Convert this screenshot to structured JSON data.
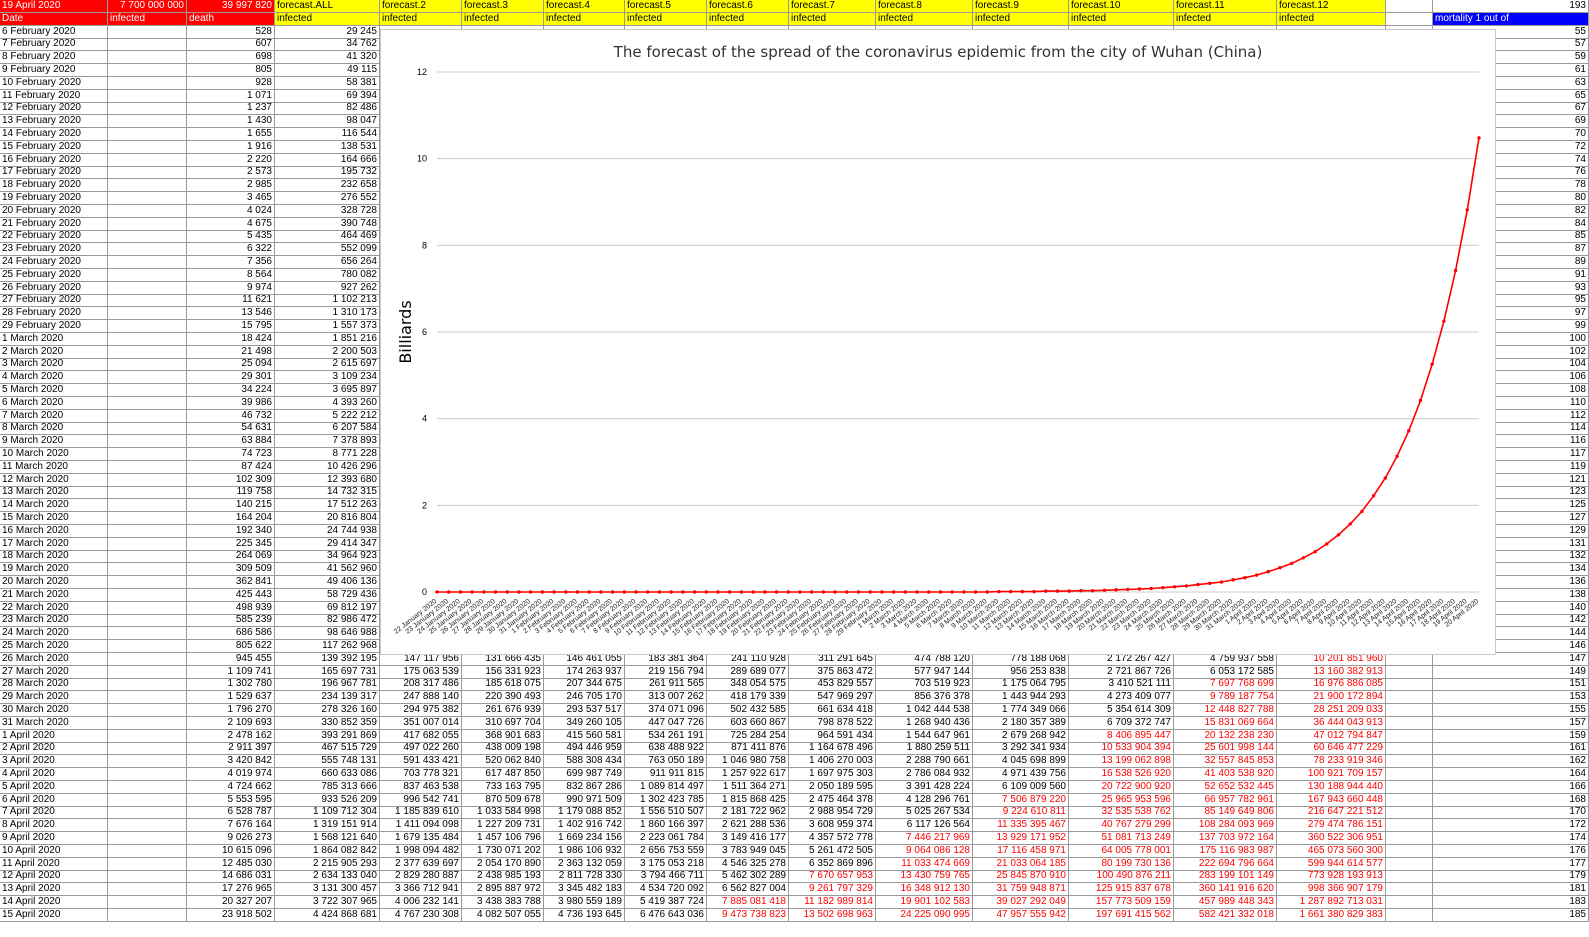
{
  "header": {
    "date_cell": "19 April 2020",
    "population": "7 700 000 000",
    "deaths_total": "39 997 820",
    "forecast_all": "forecast.ALL",
    "forecasts": [
      "forecast.2",
      "forecast.3",
      "forecast.4",
      "forecast.5",
      "forecast.6",
      "forecast.7",
      "forecast.8",
      "forecast.9",
      "forecast.10",
      "forecast.11",
      "forecast.12"
    ],
    "top_right_value": "193",
    "mortality_label": "mortality 1 out of"
  },
  "subheader": {
    "date": "Date",
    "infected": "infected",
    "death": "death",
    "infected_label": "infected"
  },
  "rows": [
    {
      "date": "6 February 2020",
      "death": "528",
      "all": "29 245",
      "f": [],
      "m": "55"
    },
    {
      "date": "7 February 2020",
      "death": "607",
      "all": "34 762",
      "f": [],
      "m": "57"
    },
    {
      "date": "8 February 2020",
      "death": "698",
      "all": "41 320",
      "f": [],
      "m": "59"
    },
    {
      "date": "9 February 2020",
      "death": "805",
      "all": "49 115",
      "f": [],
      "m": "61"
    },
    {
      "date": "10 February 2020",
      "death": "928",
      "all": "58 381",
      "f": [],
      "m": "63"
    },
    {
      "date": "11 February 2020",
      "death": "1 071",
      "all": "69 394",
      "f": [],
      "m": "65"
    },
    {
      "date": "12 February 2020",
      "death": "1 237",
      "all": "82 486",
      "f": [],
      "m": "67"
    },
    {
      "date": "13 February 2020",
      "death": "1 430",
      "all": "98 047",
      "f": [],
      "m": "69"
    },
    {
      "date": "14 February 2020",
      "death": "1 655",
      "all": "116 544",
      "f": [],
      "m": "70"
    },
    {
      "date": "15 February 2020",
      "death": "1 916",
      "all": "138 531",
      "f": [],
      "m": "72"
    },
    {
      "date": "16 February 2020",
      "death": "2 220",
      "all": "164 666",
      "f": [],
      "m": "74"
    },
    {
      "date": "17 February 2020",
      "death": "2 573",
      "all": "195 732",
      "f": [],
      "m": "76"
    },
    {
      "date": "18 February 2020",
      "death": "2 985",
      "all": "232 658",
      "f": [],
      "m": "78"
    },
    {
      "date": "19 February 2020",
      "death": "3 465",
      "all": "276 552",
      "f": [],
      "m": "80"
    },
    {
      "date": "20 February 2020",
      "death": "4 024",
      "all": "328 728",
      "f": [],
      "m": "82"
    },
    {
      "date": "21 February 2020",
      "death": "4 675",
      "all": "390 748",
      "f": [],
      "m": "84"
    },
    {
      "date": "22 February 2020",
      "death": "5 435",
      "all": "464 469",
      "f": [],
      "m": "85"
    },
    {
      "date": "23 February 2020",
      "death": "6 322",
      "all": "552 099",
      "f": [],
      "m": "87"
    },
    {
      "date": "24 February 2020",
      "death": "7 356",
      "all": "656 264",
      "f": [],
      "m": "89"
    },
    {
      "date": "25 February 2020",
      "death": "8 564",
      "all": "780 082",
      "f": [],
      "m": "91"
    },
    {
      "date": "26 February 2020",
      "death": "9 974",
      "all": "927 262",
      "f": [],
      "m": "93"
    },
    {
      "date": "27 February 2020",
      "death": "11 621",
      "all": "1 102 213",
      "f": [],
      "m": "95"
    },
    {
      "date": "28 February 2020",
      "death": "13 546",
      "all": "1 310 173",
      "f": [],
      "m": "97"
    },
    {
      "date": "29 February 2020",
      "death": "15 795",
      "all": "1 557 373",
      "f": [],
      "m": "99"
    },
    {
      "date": "1 March 2020",
      "death": "18 424",
      "all": "1 851 216",
      "f": [],
      "m": "100"
    },
    {
      "date": "2 March 2020",
      "death": "21 498",
      "all": "2 200 503",
      "f": [],
      "m": "102"
    },
    {
      "date": "3 March 2020",
      "death": "25 094",
      "all": "2 615 697",
      "f": [],
      "m": "104"
    },
    {
      "date": "4 March 2020",
      "death": "29 301",
      "all": "3 109 234",
      "f": [],
      "m": "106"
    },
    {
      "date": "5 March 2020",
      "death": "34 224",
      "all": "3 695 897",
      "f": [],
      "m": "108"
    },
    {
      "date": "6 March 2020",
      "death": "39 986",
      "all": "4 393 260",
      "f": [],
      "m": "110"
    },
    {
      "date": "7 March 2020",
      "death": "46 732",
      "all": "5 222 212",
      "f": [],
      "m": "112"
    },
    {
      "date": "8 March 2020",
      "death": "54 631",
      "all": "6 207 584",
      "f": [],
      "m": "114"
    },
    {
      "date": "9 March 2020",
      "death": "63 884",
      "all": "7 378 893",
      "f": [],
      "m": "116"
    },
    {
      "date": "10 March 2020",
      "death": "74 723",
      "all": "8 771 228",
      "f": [],
      "m": "117"
    },
    {
      "date": "11 March 2020",
      "death": "87 424",
      "all": "10 426 296",
      "f": [],
      "m": "119"
    },
    {
      "date": "12 March 2020",
      "death": "102 309",
      "all": "12 393 680",
      "f": [],
      "m": "121"
    },
    {
      "date": "13 March 2020",
      "death": "119 758",
      "all": "14 732 315",
      "f": [],
      "m": "123"
    },
    {
      "date": "14 March 2020",
      "death": "140 215",
      "all": "17 512 263",
      "f": [],
      "m": "125"
    },
    {
      "date": "15 March 2020",
      "death": "164 204",
      "all": "20 816 804",
      "f": [],
      "m": "127"
    },
    {
      "date": "16 March 2020",
      "death": "192 340",
      "all": "24 744 938",
      "f": [],
      "m": "129"
    },
    {
      "date": "17 March 2020",
      "death": "225 345",
      "all": "29 414 347",
      "f": [],
      "m": "131"
    },
    {
      "date": "18 March 2020",
      "death": "264 069",
      "all": "34 964 923",
      "f": [],
      "m": "132"
    },
    {
      "date": "19 March 2020",
      "death": "309 509",
      "all": "41 562 960",
      "f": [],
      "m": "134"
    },
    {
      "date": "20 March 2020",
      "death": "362 841",
      "all": "49 406 136",
      "f": [],
      "m": "136"
    },
    {
      "date": "21 March 2020",
      "death": "425 443",
      "all": "58 729 436",
      "f": [],
      "m": "138"
    },
    {
      "date": "22 March 2020",
      "death": "498 939",
      "all": "69 812 197",
      "f": [],
      "m": "140"
    },
    {
      "date": "23 March 2020",
      "death": "585 239",
      "all": "82 986 472",
      "f": [],
      "m": "142"
    },
    {
      "date": "24 March 2020",
      "death": "686 586",
      "all": "98 646 988",
      "f": [],
      "m": "144"
    },
    {
      "date": "25 March 2020",
      "death": "805 622",
      "all": "117 262 968",
      "f": [],
      "m": "146"
    },
    {
      "date": "26 March 2020",
      "death": "945 455",
      "all": "139 392 195",
      "f": [
        "147 117 956",
        "131 666 435",
        "146 461 055",
        "183 381 364",
        "241 110 928",
        "311 291 645",
        "474 788 120",
        "778 188 068",
        "2 172 267 427",
        "4 759 937 558",
        "10 201 851 960"
      ],
      "m": "147"
    },
    {
      "date": "27 March 2020",
      "death": "1 109 741",
      "all": "165 697 731",
      "f": [
        "175 063 539",
        "156 331 923",
        "174 263 937",
        "219 156 794",
        "289 689 077",
        "375 863 472",
        "577 947 144",
        "956 253 838",
        "2 721 867 726",
        "6 053 172 585",
        "13 160 382 913"
      ],
      "m": "149"
    },
    {
      "date": "28 March 2020",
      "death": "1 302 780",
      "all": "196 967 781",
      "f": [
        "208 317 486",
        "185 618 075",
        "207 344 675",
        "261 911 565",
        "348 054 575",
        "453 829 557",
        "703 519 923",
        "1 175 064 795",
        "3 410 521 111",
        "7 697 768 699",
        "16 976 886 085"
      ],
      "m": "151"
    },
    {
      "date": "29 March 2020",
      "death": "1 529 637",
      "all": "234 139 317",
      "f": [
        "247 888 140",
        "220 390 493",
        "246 705 170",
        "313 007 262",
        "418 179 339",
        "547 969 297",
        "856 376 378",
        "1 443 944 293",
        "4 273 409 077",
        "9 789 187 754",
        "21 900 172 894"
      ],
      "m": "153"
    },
    {
      "date": "30 March 2020",
      "death": "1 796 270",
      "all": "278 326 160",
      "f": [
        "294 975 382",
        "261 676 939",
        "293 537 517",
        "374 071 096",
        "502 432 585",
        "661 634 418",
        "1 042 444 538",
        "1 774 349 066",
        "5 354 614 309",
        "12 448 827 788",
        "28 251 209 033"
      ],
      "m": "155"
    },
    {
      "date": "31 March 2020",
      "death": "2 109 693",
      "all": "330 852 359",
      "f": [
        "351 007 014",
        "310 697 704",
        "349 260 105",
        "447 047 726",
        "603 660 867",
        "798 878 522",
        "1 268 940 436",
        "2 180 357 389",
        "6 709 372 747",
        "15 831 069 664",
        "36 444 043 913"
      ],
      "m": "157"
    },
    {
      "date": "1 April 2020",
      "death": "2 478 162",
      "all": "393 291 869",
      "f": [
        "417 682 055",
        "368 901 683",
        "415 560 581",
        "534 261 191",
        "725 284 254",
        "964 591 434",
        "1 544 647 961",
        "2 679 268 942",
        "8 406 895 447",
        "20 132 238 230",
        "47 012 794 847"
      ],
      "m": "159"
    },
    {
      "date": "2 April 2020",
      "death": "2 911 397",
      "all": "467 515 729",
      "f": [
        "497 022 260",
        "438 009 198",
        "494 446 959",
        "638 488 922",
        "871 411 876",
        "1 164 678 496",
        "1 880 259 511",
        "3 292 341 934",
        "10 533 904 394",
        "25 601 998 144",
        "60 646 477 229"
      ],
      "m": "161"
    },
    {
      "date": "3 April 2020",
      "death": "3 420 842",
      "all": "555 748 131",
      "f": [
        "591 433 421",
        "520 062 840",
        "588 308 434",
        "763 050 189",
        "1 046 980 758",
        "1 406 270 003",
        "2 288 790 661",
        "4 045 698 899",
        "13 199 062 898",
        "32 557 845 853",
        "78 233 919 346"
      ],
      "m": "162"
    },
    {
      "date": "4 April 2020",
      "death": "4 019 974",
      "all": "660 633 086",
      "f": [
        "703 778 321",
        "617 487 850",
        "699 987 749",
        "911 911 815",
        "1 257 922 617",
        "1 697 975 303",
        "2 786 084 932",
        "4 971 439 756",
        "16 538 526 920",
        "41 403 538 920",
        "100 921 709 157"
      ],
      "m": "164"
    },
    {
      "date": "5 April 2020",
      "death": "4 724 662",
      "all": "785 313 666",
      "f": [
        "837 463 538",
        "733 163 795",
        "832 867 286",
        "1 089 814 497",
        "1 511 364 271",
        "2 050 189 595",
        "3 391 428 224",
        "6 109 009 560",
        "20 722 900 920",
        "52 652 532 445",
        "130 188 944 440"
      ],
      "m": "166"
    },
    {
      "date": "6 April 2020",
      "death": "5 553 595",
      "all": "933 526 209",
      "f": [
        "996 542 741",
        "870 509 678",
        "990 971 509",
        "1 302 423 785",
        "1 815 868 425",
        "2 475 464 378",
        "4 128 296 761",
        "7 506 879 220",
        "25 965 953 596",
        "66 957 782 961",
        "167 943 660 448"
      ],
      "m": "168"
    },
    {
      "date": "7 April 2020",
      "death": "6 528 787",
      "all": "1 109 712 304",
      "f": [
        "1 185 839 610",
        "1 033 584 998",
        "1 179 088 852",
        "1 556 510 507",
        "2 181 722 962",
        "2 988 954 729",
        "5 025 267 534",
        "9 224 610 811",
        "32 535 538 762",
        "85 149 649 806",
        "216 647 221 512"
      ],
      "m": "170"
    },
    {
      "date": "8 April 2020",
      "death": "7 676 164",
      "all": "1 319 151 914",
      "f": [
        "1 411 094 098",
        "1 227 209 731",
        "1 402 916 742",
        "1 860 166 397",
        "2 621 288 536",
        "3 608 959 374",
        "6 117 126 564",
        "11 335 395 467",
        "40 767 279 299",
        "108 284 093 969",
        "279 474 786 151"
      ],
      "m": "172"
    },
    {
      "date": "9 April 2020",
      "death": "9 026 273",
      "all": "1 568 121 640",
      "f": [
        "1 679 135 484",
        "1 457 106 796",
        "1 669 234 156",
        "2 223 061 784",
        "3 149 416 177",
        "4 357 572 778",
        "7 446 217 969",
        "13 929 171 952",
        "51 081 713 249",
        "137 703 972 164",
        "360 522 306 951"
      ],
      "m": "174"
    },
    {
      "date": "10 April 2020",
      "death": "10 615 096",
      "all": "1 864 082 842",
      "f": [
        "1 998 094 482",
        "1 730 071 202",
        "1 986 106 932",
        "2 656 753 559",
        "3 783 949 045",
        "5 261 472 505",
        "9 064 086 128",
        "17 116 458 971",
        "64 005 778 001",
        "175 116 983 987",
        "465 073 560 300"
      ],
      "m": "176"
    },
    {
      "date": "11 April 2020",
      "death": "12 485 030",
      "all": "2 215 905 293",
      "f": [
        "2 377 639 697",
        "2 054 170 890",
        "2 363 132 059",
        "3 175 053 218",
        "4 546 325 278",
        "6 352 869 896",
        "11 033 474 669",
        "21 033 064 185",
        "80 199 730 136",
        "222 694 796 664",
        "599 944 614 577"
      ],
      "m": "177"
    },
    {
      "date": "12 April 2020",
      "death": "14 686 031",
      "all": "2 634 133 040",
      "f": [
        "2 829 280 887",
        "2 438 985 193",
        "2 811 728 330",
        "3 794 466 711",
        "5 462 302 289",
        "7 670 657 953",
        "13 430 759 765",
        "25 845 870 910",
        "100 490 876 211",
        "283 199 101 149",
        "773 928 193 913"
      ],
      "m": "179"
    },
    {
      "date": "13 April 2020",
      "death": "17 276 965",
      "all": "3 131 300 457",
      "f": [
        "3 366 712 941",
        "2 895 887 972",
        "3 345 482 183",
        "4 534 720 092",
        "6 562 827 004",
        "9 261 797 329",
        "16 348 912 130",
        "31 759 948 871",
        "125 915 837 678",
        "360 141 916 620",
        "998 366 907 179"
      ],
      "m": "181"
    },
    {
      "date": "14 April 2020",
      "death": "20 327 207",
      "all": "3 722 307 965",
      "f": [
        "4 006 232 141",
        "3 438 383 788",
        "3 980 559 189",
        "5 419 387 724",
        "7 885 081 418",
        "11 182 989 814",
        "19 901 102 583",
        "39 027 292 049",
        "157 773 509 159",
        "457 989 448 343",
        "1 287 892 713 031"
      ],
      "m": "183"
    },
    {
      "date": "15 April 2020",
      "death": "23 918 502",
      "all": "4 424 868 681",
      "f": [
        "4 767 230 308",
        "4 082 507 055",
        "4 736 193 645",
        "6 476 643 036",
        "9 473 738 823",
        "13 502 698 963",
        "24 225 090 995",
        "47 957 555 942",
        "197 691 415 562",
        "582 421 332 018",
        "1 661 380 829 383"
      ],
      "m": "185"
    }
  ],
  "colors": {
    "header_red": "#ff0000",
    "header_yellow": "#ffff00",
    "header_blue": "#0000ff",
    "line_red": "#ff0000",
    "negative_text": "#ff0000",
    "grid": "#cccccc"
  },
  "chart_data": {
    "type": "line",
    "title": "The forecast of the spread of the coronavirus epidemic from the city of Wuhan (China)",
    "xlabel": "",
    "ylabel": "Billiards",
    "ylim": [
      0,
      12
    ],
    "yticks": [
      "0",
      "2",
      "4",
      "6",
      "8",
      "10",
      "12"
    ],
    "grid": true,
    "legend": "none",
    "x": [
      "22 January 2020",
      "23 January 2020",
      "24 January 2020",
      "25 January 2020",
      "26 January 2020",
      "27 January 2020",
      "28 January 2020",
      "29 January 2020",
      "30 January 2020",
      "31 January 2020",
      "1 February 2020",
      "2 February 2020",
      "3 February 2020",
      "4 February 2020",
      "5 February 2020",
      "6 February 2020",
      "7 February 2020",
      "8 February 2020",
      "9 February 2020",
      "10 February 2020",
      "11 February 2020",
      "12 February 2020",
      "13 February 2020",
      "14 February 2020",
      "15 February 2020",
      "16 February 2020",
      "17 February 2020",
      "18 February 2020",
      "19 February 2020",
      "20 February 2020",
      "21 February 2020",
      "22 February 2020",
      "23 February 2020",
      "24 February 2020",
      "25 February 2020",
      "26 February 2020",
      "27 February 2020",
      "28 February 2020",
      "29 February 2020",
      "1 March 2020",
      "2 March 2020",
      "3 March 2020",
      "4 March 2020",
      "5 March 2020",
      "6 March 2020",
      "7 March 2020",
      "8 March 2020",
      "9 March 2020",
      "10 March 2020",
      "11 March 2020",
      "12 March 2020",
      "13 March 2020",
      "14 March 2020",
      "15 March 2020",
      "16 March 2020",
      "17 March 2020",
      "18 March 2020",
      "19 March 2020",
      "20 March 2020",
      "21 March 2020",
      "22 March 2020",
      "23 March 2020",
      "24 March 2020",
      "25 March 2020",
      "26 March 2020",
      "27 March 2020",
      "28 March 2020",
      "29 March 2020",
      "30 March 2020",
      "31 March 2020",
      "1 April 2020",
      "2 April 2020",
      "3 April 2020",
      "4 April 2020",
      "5 April 2020",
      "6 April 2020",
      "7 April 2020",
      "8 April 2020",
      "9 April 2020",
      "10 April 2020",
      "11 April 2020",
      "12 April 2020",
      "13 April 2020",
      "14 April 2020",
      "15 April 2020",
      "16 April 2020",
      "17 April 2020",
      "18 April 2020",
      "19 April 2020",
      "20 April 2020"
    ],
    "series": [
      {
        "values": [
          0,
          0,
          0,
          0,
          0,
          0,
          0,
          0,
          0,
          0,
          0,
          0,
          0,
          0,
          0,
          0,
          0,
          0,
          0,
          0,
          0,
          0,
          0,
          0,
          0,
          0,
          0,
          0,
          0,
          0,
          0,
          0,
          0,
          0,
          0,
          0,
          0,
          0,
          0,
          0,
          0,
          0,
          0,
          0,
          0,
          0,
          0,
          0,
          0.01,
          0.01,
          0.01,
          0.01,
          0.02,
          0.02,
          0.02,
          0.03,
          0.03,
          0.04,
          0.05,
          0.06,
          0.07,
          0.08,
          0.1,
          0.12,
          0.14,
          0.17,
          0.2,
          0.23,
          0.28,
          0.33,
          0.39,
          0.47,
          0.56,
          0.66,
          0.79,
          0.93,
          1.11,
          1.32,
          1.57,
          1.86,
          2.22,
          2.63,
          3.13,
          3.72,
          4.42,
          5.26,
          6.25,
          7.42,
          8.82,
          10.48
        ]
      }
    ]
  }
}
